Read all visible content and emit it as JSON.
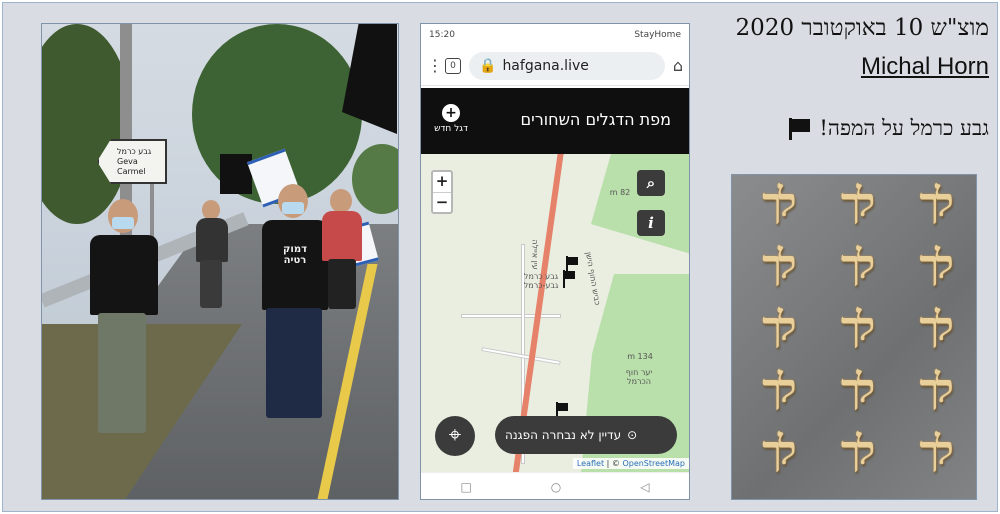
{
  "header": {
    "date_line": "מוצ\"ש 10 באוקטובר 2020",
    "author": "Michal Horn",
    "caption": "גבע כרמל על המפה!"
  },
  "photo": {
    "sign_text_1": "גבע כרמל",
    "sign_text_2": "Geva Carmel",
    "shirt_text_1": "דמוק",
    "shirt_text_2": "רטיה"
  },
  "phone": {
    "time": "15:20",
    "status_right": "StayHome",
    "url": "hafgana.live",
    "tab_count": "0",
    "app_title": "מפת הדגלים השחורים",
    "new_flag_label": "דגל חדש",
    "zoom_in": "+",
    "zoom_out": "−",
    "protest_status": "עדיין לא נבחרה הפגנה",
    "map_labels": {
      "village": "גבע כרמל",
      "village_en": "גבע-כרמל",
      "road": "כביש החוף הישן",
      "elevation_1": "82 m",
      "elevation_2": "134 m",
      "forest": "יער חוף הכרמל",
      "side_road": "עין איילה"
    },
    "attribution_leaflet": "Leaflet",
    "attribution_sep": " | © ",
    "attribution_osm": "OpenStreetMap"
  },
  "cookies": {
    "rows": [
      [
        "לך",
        "לך",
        "לך"
      ],
      [
        "לך",
        "לך",
        "לך"
      ],
      [
        "לך",
        "לך",
        "לך"
      ],
      [
        "לך",
        "לך",
        "לך"
      ],
      [
        "לך",
        "לך",
        "לך"
      ]
    ]
  },
  "colors": {
    "frame_background": "#d9dde3",
    "map_road": "#e6816a",
    "app_header": "#0f0f0f"
  }
}
